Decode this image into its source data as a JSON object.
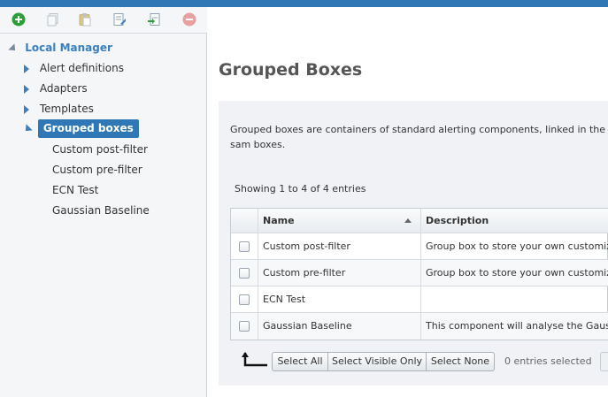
{
  "toolbar": {
    "icons": [
      "add-icon",
      "copy-icon",
      "paste-icon",
      "edit-icon",
      "export-icon",
      "delete-icon"
    ],
    "colors": {
      "add": "#2e9e3a",
      "delete": "#e07070",
      "disabled": "#b9c2cb"
    }
  },
  "tree": {
    "root": "Local Manager",
    "items": [
      {
        "label": "Alert definitions"
      },
      {
        "label": "Adapters"
      },
      {
        "label": "Templates"
      },
      {
        "label": "Grouped boxes"
      }
    ],
    "children": [
      {
        "label": "Custom post-filter"
      },
      {
        "label": "Custom pre-filter"
      },
      {
        "label": "ECN Test"
      },
      {
        "label": "Gaussian Baseline"
      }
    ]
  },
  "main": {
    "title": "Grouped Boxes",
    "description": "Grouped boxes are containers of standard alerting components, linked in the sam boxes.",
    "showing": "Showing 1 to 4 of 4 entries",
    "columns": {
      "name": "Name",
      "description": "Description"
    },
    "rows": [
      {
        "name": "Custom post-filter",
        "description": "Group box to store your own customiza"
      },
      {
        "name": "Custom pre-filter",
        "description": "Group box to store your own customiza"
      },
      {
        "name": "ECN Test",
        "description": ""
      },
      {
        "name": "Gaussian Baseline",
        "description": "This component will analyse the Gauss"
      }
    ],
    "buttons": {
      "select_all": "Select All",
      "select_visible": "Select Visible Only",
      "select_none": "Select None"
    },
    "selected_count": "0 entries selected"
  },
  "colors": {
    "accent": "#2f78b5",
    "tree_text": "#3a7fc0"
  }
}
